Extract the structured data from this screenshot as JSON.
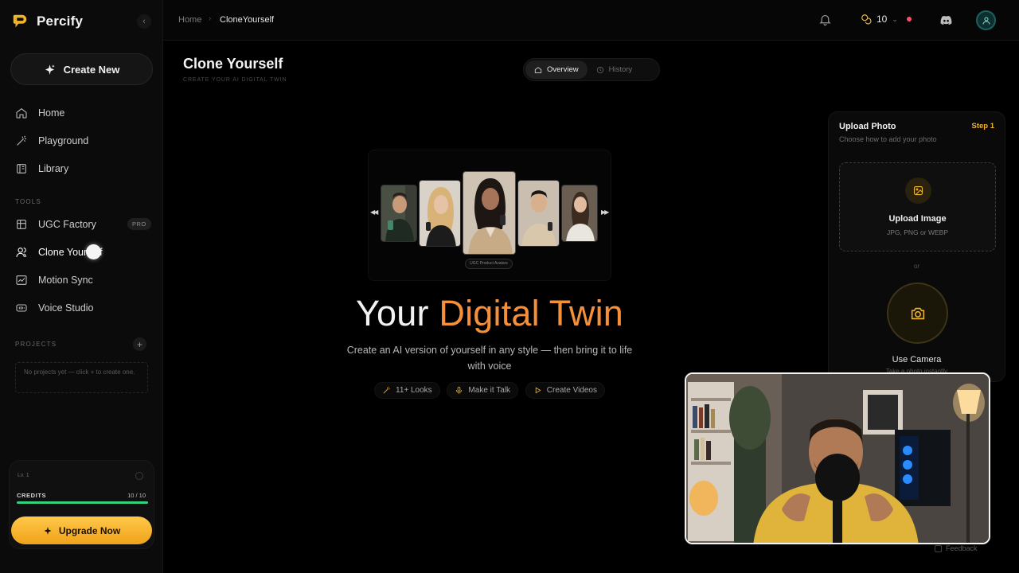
{
  "app": {
    "name": "Percify"
  },
  "sidebar": {
    "create_new": "Create New",
    "nav": [
      {
        "label": "Home",
        "icon": "home-icon"
      },
      {
        "label": "Playground",
        "icon": "wand-icon"
      },
      {
        "label": "Library",
        "icon": "library-icon"
      }
    ],
    "tools_label": "TOOLS",
    "tools": [
      {
        "label": "UGC Factory",
        "icon": "grid-icon",
        "badge": "PRO"
      },
      {
        "label": "Clone Yourself",
        "icon": "users-icon",
        "active": true
      },
      {
        "label": "Motion Sync",
        "icon": "chart-icon"
      },
      {
        "label": "Voice Studio",
        "icon": "audio-icon"
      }
    ],
    "projects_label": "PROJECTS",
    "no_projects": "No projects yet — click + to create one.",
    "level": "Lv. 1",
    "credits_label": "CREDITS",
    "credits_value": "10 / 10",
    "credits_fraction": 1.0,
    "upgrade": "Upgrade Now"
  },
  "topbar": {
    "breadcrumb_home": "Home",
    "breadcrumb_current": "CloneYourself",
    "coins": "10"
  },
  "header": {
    "title": "Clone Yourself",
    "subtitle": "CREATE YOUR AI DIGITAL TWIN",
    "tabs": [
      {
        "label": "Overview",
        "active": true
      },
      {
        "label": "History"
      }
    ]
  },
  "hero": {
    "title_plain": "Your ",
    "title_accent": "Digital Twin",
    "description": "Create an AI version of yourself in any style — then bring it to life with voice",
    "showcase_label": "UGC Product Avatars",
    "features": [
      {
        "label": "11+ Looks",
        "icon": "wand-icon"
      },
      {
        "label": "Make it Talk",
        "icon": "mic-icon"
      },
      {
        "label": "Create Videos",
        "icon": "play-icon"
      }
    ],
    "accent_color": "#f5903a"
  },
  "upload": {
    "title": "Upload Photo",
    "step": "Step 1",
    "subtitle": "Choose how to add your photo",
    "dropzone_title": "Upload Image",
    "dropzone_sub": "JPG, PNG or WEBP",
    "or": "or",
    "camera_title": "Use Camera",
    "camera_sub": "Take a photo instantly"
  },
  "footer": {
    "feedback": "Feedback"
  },
  "colors": {
    "brand": "#f0b429",
    "upgrade": "#f5b02a",
    "credits_bar": "#34d17e"
  }
}
